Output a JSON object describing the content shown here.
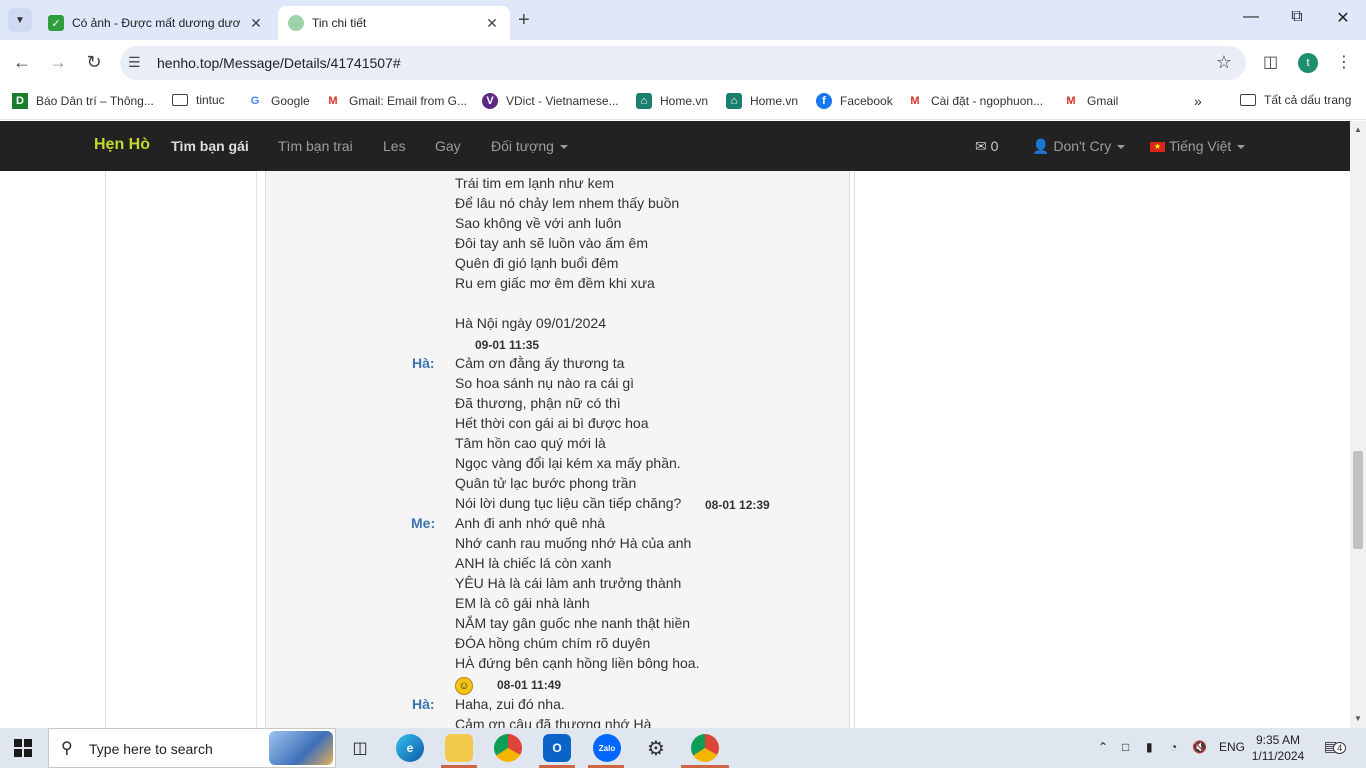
{
  "browser": {
    "tabs": [
      {
        "title": "Có ảnh - Được mất dương dươ",
        "active": false
      },
      {
        "title": "Tin chi tiết",
        "active": true
      }
    ],
    "url": "henho.top/Message/Details/41741507#",
    "profile_initial": "t",
    "bookmarks": [
      {
        "label": "Báo Dân trí – Thông...",
        "icon": "D"
      },
      {
        "label": "tintuc",
        "icon": "folder-icon"
      },
      {
        "label": "Google",
        "icon": "G"
      },
      {
        "label": "Gmail: Email from G...",
        "icon": "M"
      },
      {
        "label": "VDict - Vietnamese...",
        "icon": "V"
      },
      {
        "label": "Home.vn",
        "icon": "home-icon"
      },
      {
        "label": "Home.vn",
        "icon": "home-icon"
      },
      {
        "label": "Facebook",
        "icon": "f"
      },
      {
        "label": "Cài đặt - ngophuon...",
        "icon": "M"
      },
      {
        "label": "Gmail",
        "icon": "M"
      }
    ],
    "all_bookmarks": "Tất cả dấu trang"
  },
  "site": {
    "brand": "Hẹn Hò",
    "nav": [
      "Tìm bạn gái",
      "Tìm bạn trai",
      "Les",
      "Gay",
      "Đối tượng"
    ],
    "messages_count": "0",
    "user": "Don't Cry",
    "language": "Tiếng Việt"
  },
  "conversation": {
    "lines": [
      "Trái tim em lạnh như kem",
      "Để lâu nó chảy lem nhem thấy buồn",
      "Sao không về với anh luôn",
      "Đôi tay anh sẽ luồn vào ấm êm",
      "Quên đi gió lạnh buổi đêm",
      "Ru em giấc mơ êm đềm khi xưa",
      "",
      "Hà Nội ngày 09/01/2024",
      "Cảm ơn đằng ấy thương ta",
      "So hoa sánh nụ nào ra cái gì",
      "Đã thương, phận nữ có thì",
      "Hết thời con gái ai bì được hoa",
      "Tâm hồn cao quý mới là",
      "Ngọc vàng đổi lại kém xa mấy phần.",
      "Quân tử lạc bước phong trần",
      "Nói lời dung tục liệu cần tiếp chăng?",
      "Anh đi anh nhớ quê nhà",
      "Nhớ canh rau muống nhớ Hà của anh",
      "ANH là chiếc lá còn xanh",
      "YÊU Hà là cái làm anh trưởng thành",
      "EM là cô gái nhà lành",
      "NẮM tay gân guốc nhe nanh thật hiền",
      "ĐÓA hồng chúm chím rõ duyên",
      "HÀ đứng bên cạnh hồng liền bông hoa.",
      "Haha, zui đó nha.",
      "Cảm ơn cậu đã thương nhớ Hà"
    ],
    "speakers": [
      "Hà:",
      "Me:",
      "Hà:"
    ],
    "times": [
      "09-01 11:35",
      "08-01 12:39",
      "08-01 11:49"
    ],
    "emoji": "grinning-face"
  },
  "taskbar": {
    "search_placeholder": "Type here to search",
    "lang": "ENG",
    "time": "9:35 AM",
    "date": "1/11/2024",
    "notifications": "4"
  },
  "colors": {
    "navbar": "#222222",
    "brand": "#c5d82f",
    "speaker": "#3a74b0",
    "tabstrip": "#dfe8f8"
  }
}
